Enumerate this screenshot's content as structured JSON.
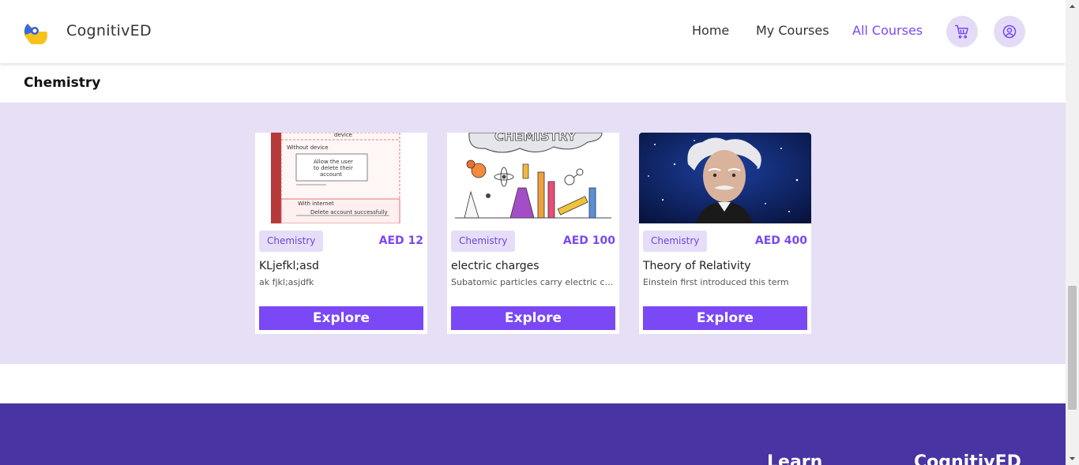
{
  "header": {
    "brand": "CognitivED",
    "nav": {
      "home": "Home",
      "my_courses": "My Courses",
      "all_courses": "All Courses"
    },
    "cart_icon": "cart-icon",
    "user_icon": "user-circle-icon"
  },
  "section": {
    "title": "Chemistry"
  },
  "courses": [
    {
      "tag": "Chemistry",
      "price": "AED 12",
      "title": "KLjefkl;asd",
      "description": "ak fjkl;asjdfk",
      "button": "Explore",
      "image": "flowchart-diagram"
    },
    {
      "tag": "Chemistry",
      "price": "AED 100",
      "title": "electric charges",
      "description": "Subatomic particles carry electric charge",
      "button": "Explore",
      "image": "chemistry-doodle"
    },
    {
      "tag": "Chemistry",
      "price": "AED 400",
      "title": "Theory of Relativity",
      "description": "Einstein first introduced this term",
      "button": "Explore",
      "image": "einstein-space"
    }
  ],
  "thumb_text": {
    "flow1": "device",
    "flow2": "Without device",
    "flow3": "Allow the user",
    "flow4": "to delete their",
    "flow5": "account",
    "flow6": "With internet",
    "flow7": "Delete account successfully",
    "chem": "CHEMISTRY"
  },
  "footer": {
    "col1": "Learn",
    "col2": "CognitivED"
  },
  "colors": {
    "accent": "#7a48f5",
    "band": "#e6dff5",
    "footer": "#4a33a3"
  }
}
